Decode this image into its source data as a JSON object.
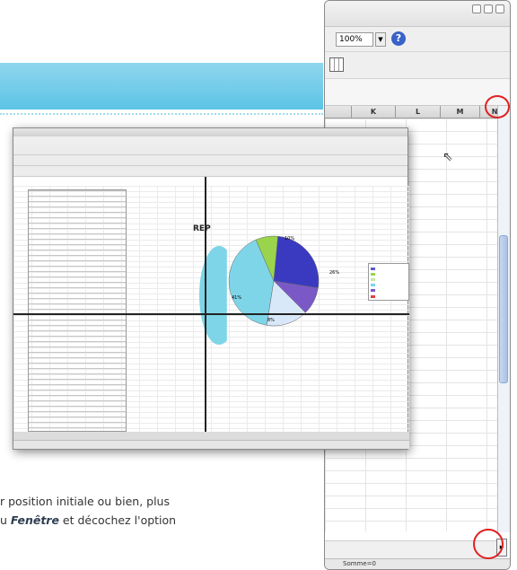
{
  "right_window": {
    "zoom_value": "100%",
    "columns": [
      "K",
      "L",
      "M",
      "N"
    ],
    "status_text": "Somme=0"
  },
  "screenshot": {
    "chart_title": "REP",
    "chart_data": {
      "type": "pie",
      "slices": [
        {
          "value": 41,
          "color": "#7fd5e8"
        },
        {
          "value": 8,
          "color": "#9ad44c"
        },
        {
          "value": 26,
          "color": "#3a3ac0"
        },
        {
          "value": 10,
          "color": "#7a59c6"
        },
        {
          "value": 15,
          "color": "#d9e8f8"
        }
      ],
      "labels": [
        "41%",
        "26%",
        "10%",
        "8%"
      ]
    },
    "legend_colors": [
      "#5a5ad0",
      "#9ad44c",
      "#c8e6a0",
      "#7fd5e8",
      "#7a59c6",
      "#e04040"
    ]
  },
  "body_text": {
    "line1": "r position initiale ou bien, plus",
    "line2_pre": "u ",
    "line2_bold": "Fenêtre",
    "line2_post": " et décochez l'option"
  },
  "colors": {
    "banner": "#5cc4e6",
    "highlight_circle": "#e02020"
  }
}
